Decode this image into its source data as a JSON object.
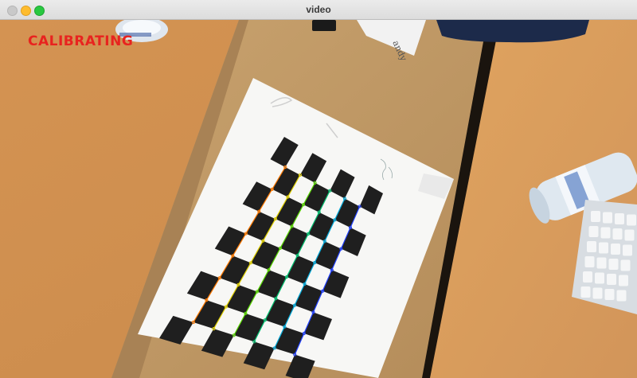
{
  "window": {
    "title": "video",
    "controls": {
      "close": "close-button",
      "minimize": "minimize-button",
      "maximize": "maximize-button"
    }
  },
  "overlay": {
    "status_text": "CALIBRATING",
    "status_color": "#e8231f"
  },
  "paper_note": "andy",
  "colors": {
    "desk": "#d89a59",
    "board_square": "#1f1f1f",
    "board_paper": "#f7f7f5",
    "corner_lines": [
      "#ff7a00",
      "#e0d000",
      "#58d800",
      "#00c070",
      "#00a8d8",
      "#2040ff",
      "#7a1fd0"
    ]
  }
}
